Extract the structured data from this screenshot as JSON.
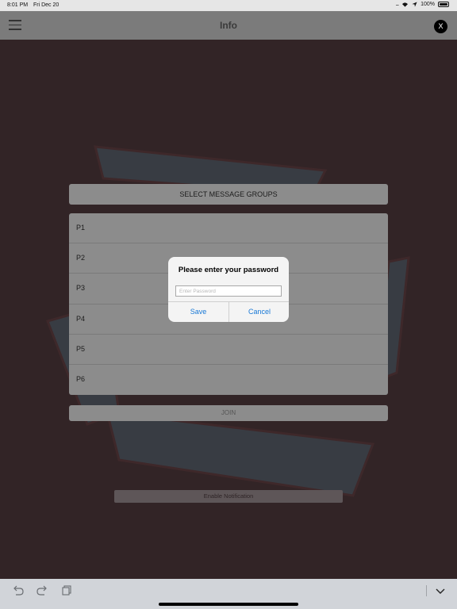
{
  "status_bar": {
    "time": "8:01 PM",
    "date": "Fri Dec 20",
    "battery": "100%",
    "icons": [
      "signal-dots-icon",
      "wifi-icon",
      "location-icon",
      "battery-icon"
    ]
  },
  "nav": {
    "title": "Info",
    "close_label": "X",
    "menu_icon": "hamburger-menu-icon"
  },
  "main": {
    "select_header": "SELECT MESSAGE GROUPS",
    "groups": [
      "P1",
      "P2",
      "P3",
      "P4",
      "P5",
      "P6"
    ],
    "join_label": "JOIN",
    "notification_label": "Enable Notification"
  },
  "dialog": {
    "title": "Please enter your password",
    "placeholder": "Enter Password",
    "value": "",
    "save_label": "Save",
    "cancel_label": "Cancel"
  },
  "toolbar": {
    "icons": [
      "undo-icon",
      "redo-icon",
      "paste-icon",
      "dismiss-keyboard-icon"
    ]
  },
  "colors": {
    "background": "#322426",
    "panel": "#8c8c8c",
    "dialog_button": "#1878d6",
    "navbar": "#7b7b7b"
  }
}
